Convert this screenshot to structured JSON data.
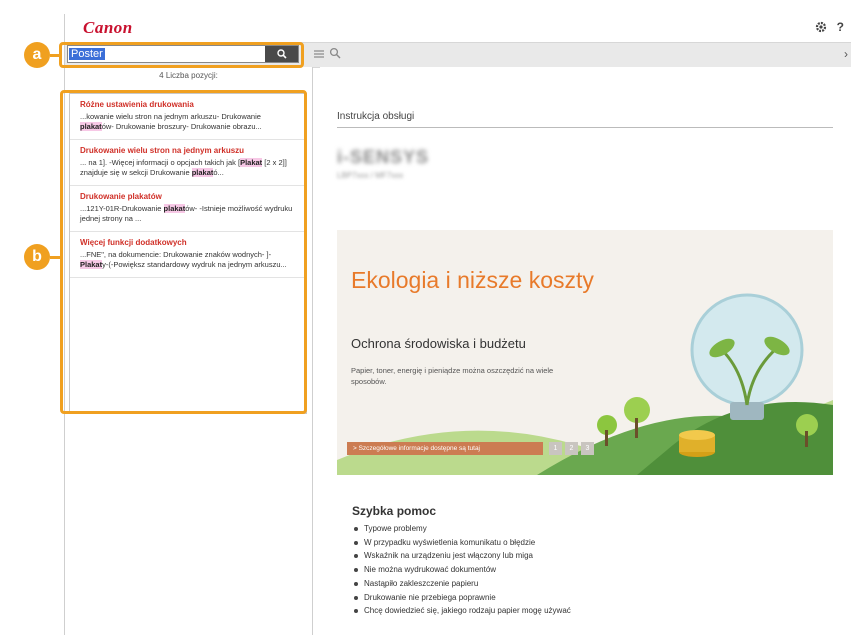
{
  "app": {
    "logo": "Canon",
    "help_label": "?"
  },
  "search": {
    "value": "Poster",
    "placeholder": "",
    "count_label": "4 Liczba pozycji:"
  },
  "results": [
    {
      "title": "Różne ustawienia drukowania",
      "parts": [
        {
          "t": "...kowanie wielu stron na jednym arkuszu- Drukowanie "
        },
        {
          "t": "plakat",
          "h": true
        },
        {
          "t": "ów- Drukowanie broszury- Drukowanie obrazu..."
        }
      ]
    },
    {
      "title": "Drukowanie wielu stron na jednym arkuszu",
      "parts": [
        {
          "t": "... na 1]. -Więcej informacji o opcjach takich jak ["
        },
        {
          "t": "Plakat",
          "h": true
        },
        {
          "t": " [2 x 2]] znajduje się w sekcji Drukowanie "
        },
        {
          "t": "plakat",
          "h": true
        },
        {
          "t": "ó..."
        }
      ]
    },
    {
      "title": "Drukowanie plakatów",
      "parts": [
        {
          "t": "...121Y-01R-Drukowanie "
        },
        {
          "t": "plakat",
          "h": true
        },
        {
          "t": "ów- -Istnieje możliwość wydruku jednej strony na ..."
        }
      ]
    },
    {
      "title": "Więcej funkcji dodatkowych",
      "parts": [
        {
          "t": "...FNE\", na dokumencie: Drukowanie znaków wodnych- ]- "
        },
        {
          "t": "Plakat",
          "h": true
        },
        {
          "t": "y-(-Powiększ standardowy wydruk na jednym arkuszu..."
        }
      ]
    }
  ],
  "content": {
    "doc_title": "Instrukcja obsługi",
    "model_name": "i-SENSYS",
    "model_sub": "LBP7xxx / MF7xxx",
    "banner": {
      "heading": "Ekologia i niższe koszty",
      "subheading": "Ochrona środowiska i budżetu",
      "text": "Papier, toner, energię i pieniądze można oszczędzić na wiele sposobów.",
      "button": ">  Szczegółowe informacje dostępne są tutaj",
      "pages": [
        "1",
        "2",
        "3"
      ]
    },
    "quick_title": "Szybka pomoc",
    "quick_items": [
      "Typowe problemy",
      "W przypadku wyświetlenia komunikatu o błędzie",
      "Wskaźnik na urządzeniu jest włączony lub miga",
      "Nie można wydrukować dokumentów",
      "Nastąpiło zakleszczenie papieru",
      "Drukowanie nie przebiega poprawnie",
      "Chcę dowiedzieć się, jakiego rodzaju papier mogę używać"
    ]
  },
  "callouts": {
    "a": "a",
    "b": "b"
  },
  "colors": {
    "accent": "#f0a020",
    "brand_red": "#c8102e",
    "link_red": "#d03028",
    "highlight": "#f7c8e6",
    "banner_orange": "#e87a2a"
  }
}
